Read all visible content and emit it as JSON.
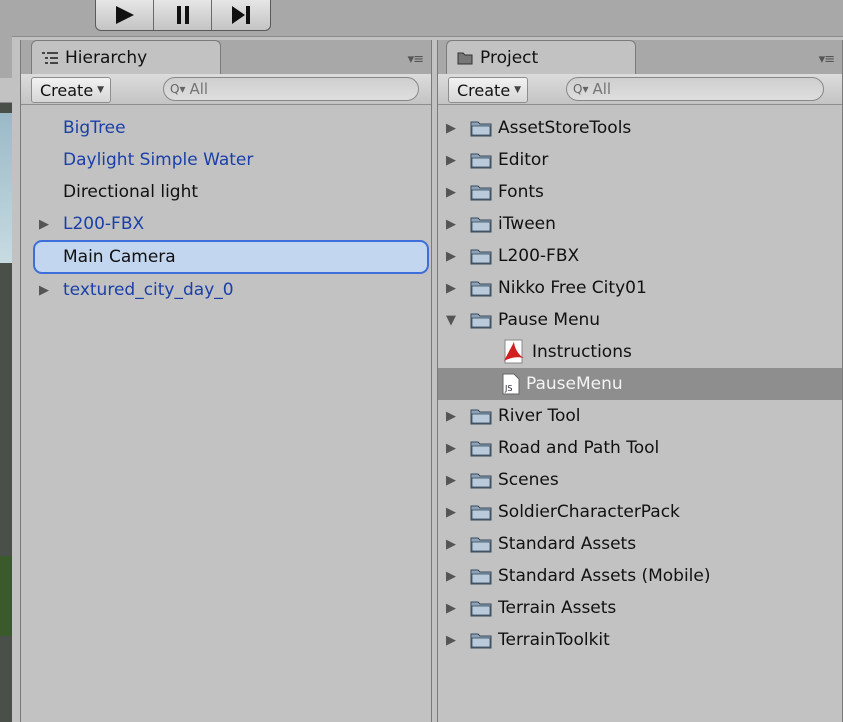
{
  "hierarchy": {
    "tab_label": "Hierarchy",
    "create_label": "Create",
    "search_placeholder": "All",
    "items": [
      {
        "label": "BigTree",
        "color": "blue",
        "expandable": false
      },
      {
        "label": "Daylight Simple Water",
        "color": "blue",
        "expandable": false
      },
      {
        "label": "Directional light",
        "color": "black",
        "expandable": false
      },
      {
        "label": "L200-FBX",
        "color": "blue",
        "expandable": true
      },
      {
        "label": "Main Camera",
        "color": "black",
        "expandable": false,
        "selected": true
      },
      {
        "label": "textured_city_day_0",
        "color": "blue",
        "expandable": true
      }
    ]
  },
  "project": {
    "tab_label": "Project",
    "create_label": "Create",
    "search_placeholder": "All",
    "items": [
      {
        "label": "AssetStoreTools",
        "type": "folder"
      },
      {
        "label": "Editor",
        "type": "folder"
      },
      {
        "label": "Fonts",
        "type": "folder"
      },
      {
        "label": "iTween",
        "type": "folder"
      },
      {
        "label": "L200-FBX",
        "type": "folder"
      },
      {
        "label": "Nikko Free City01",
        "type": "folder"
      },
      {
        "label": "Pause Menu",
        "type": "folder",
        "expanded": true
      },
      {
        "label": "Instructions",
        "type": "pdf",
        "child": true
      },
      {
        "label": "PauseMenu",
        "type": "js",
        "child": true,
        "selected": true
      },
      {
        "label": "River Tool",
        "type": "folder"
      },
      {
        "label": "Road and Path Tool",
        "type": "folder"
      },
      {
        "label": "Scenes",
        "type": "folder"
      },
      {
        "label": "SoldierCharacterPack",
        "type": "folder"
      },
      {
        "label": "Standard Assets",
        "type": "folder"
      },
      {
        "label": "Standard Assets (Mobile)",
        "type": "folder"
      },
      {
        "label": "Terrain Assets",
        "type": "folder"
      },
      {
        "label": "TerrainToolkit",
        "type": "folder"
      }
    ]
  },
  "colors": {
    "panel_bg": "#c2c2c2",
    "link_blue": "#1a3fa8",
    "selection_blue": "#c2d6f0",
    "selection_border": "#3e6ed8",
    "project_selection": "#8e8e8e"
  },
  "icons": {
    "play": "play-icon",
    "pause": "pause-icon",
    "step": "step-icon",
    "hierarchy_tab": "list-icon",
    "project_tab": "folder-icon"
  }
}
